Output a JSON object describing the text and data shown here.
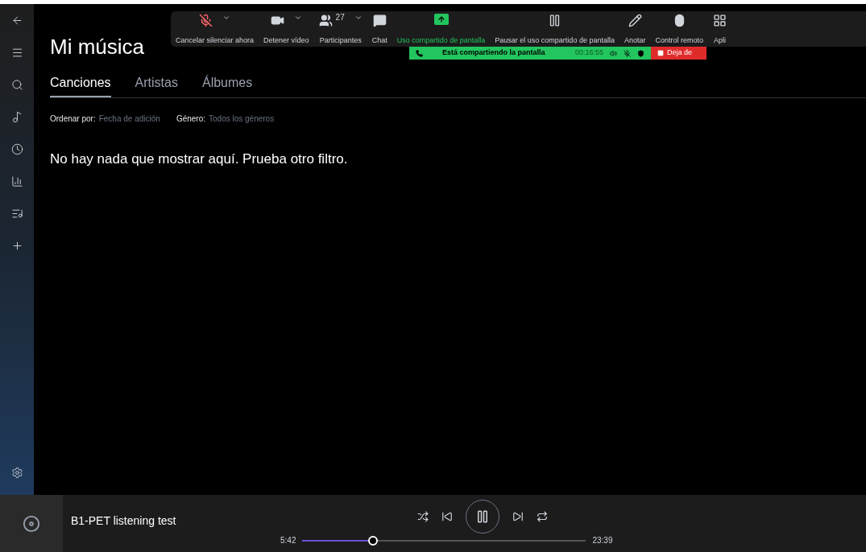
{
  "header": {
    "title": "Mi música"
  },
  "tabs": [
    {
      "label": "Canciones",
      "selected": true
    },
    {
      "label": "Artistas",
      "selected": false
    },
    {
      "label": "Álbumes",
      "selected": false
    }
  ],
  "filters": [
    {
      "label": "Ordenar por:",
      "value": "Fecha de adición"
    },
    {
      "label": "Género:",
      "value": "Todos los géneros"
    }
  ],
  "empty_message": "No hay nada que mostrar aquí. Prueba otro filtro.",
  "meeting_toolbar": {
    "buttons": [
      {
        "kind": "mic",
        "label": "Cancelar silenciar ahora",
        "menu": true,
        "active": false
      },
      {
        "kind": "video",
        "label": "Detener vídeo",
        "menu": true,
        "active": false
      },
      {
        "kind": "participants",
        "label": "Participantes",
        "count": "27",
        "menu": true,
        "active": false
      },
      {
        "kind": "chat",
        "label": "Chat",
        "menu": false,
        "active": false
      },
      {
        "kind": "share",
        "label": "Uso compartido de pantalla",
        "menu": false,
        "active": true
      },
      {
        "kind": "pause",
        "label": "Pausar el uso compartido de pantalla",
        "menu": false,
        "active": false
      },
      {
        "kind": "annotate",
        "label": "Anotar",
        "menu": false,
        "active": false
      },
      {
        "kind": "remote",
        "label": "Control remoto",
        "menu": false,
        "active": false
      },
      {
        "kind": "apps",
        "label": "Apli",
        "menu": false,
        "active": false
      }
    ],
    "share_bar": {
      "text": "Está compartiendo la pantalla",
      "time": "00:16:55",
      "stop_label": "Deja de"
    }
  },
  "player": {
    "track": "B1-PET listening test",
    "playing": true,
    "elapsed": "5:42",
    "total": "23:39",
    "level": 0.25
  }
}
